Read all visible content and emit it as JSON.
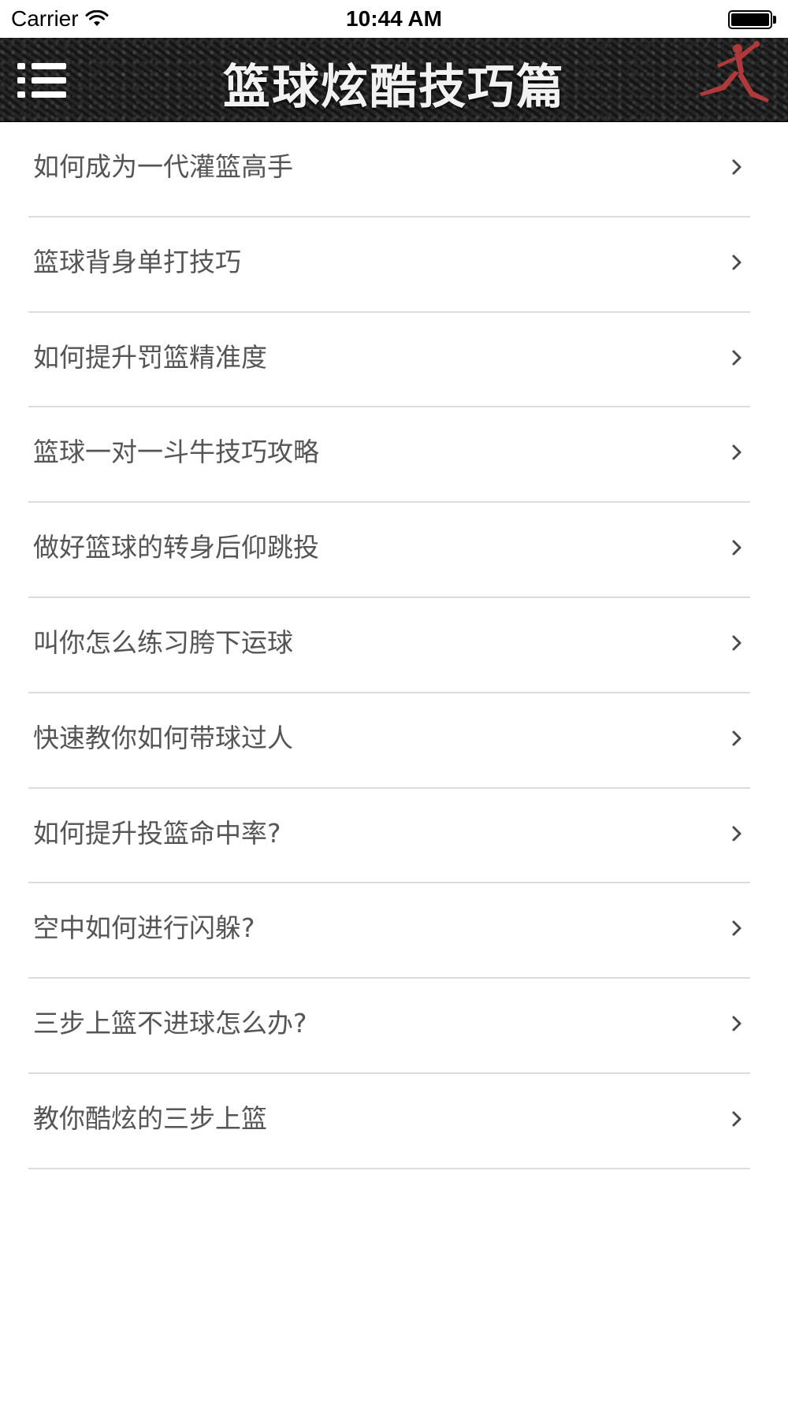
{
  "status_bar": {
    "carrier": "Carrier",
    "time": "10:44 AM",
    "icons": [
      "wifi-icon",
      "battery-icon"
    ]
  },
  "nav_bar": {
    "title": "篮球炫酷技巧篇",
    "left_icon": "menu-icon",
    "right_icon": "jumpman-logo"
  },
  "list": {
    "items": [
      {
        "label": "如何成为一代灌篮高手"
      },
      {
        "label": "篮球背身单打技巧"
      },
      {
        "label": "如何提升罚篮精准度"
      },
      {
        "label": "篮球一对一斗牛技巧攻略"
      },
      {
        "label": "做好篮球的转身后仰跳投"
      },
      {
        "label": "叫你怎么练习胯下运球"
      },
      {
        "label": "快速教你如何带球过人"
      },
      {
        "label": "如何提升投篮命中率?"
      },
      {
        "label": "空中如何进行闪躲?"
      },
      {
        "label": "三步上篮不进球怎么办?"
      },
      {
        "label": "教你酷炫的三步上篮"
      }
    ],
    "accessory_icon": "chevron-right-icon"
  },
  "colors": {
    "nav_background": "#1d1d1d",
    "nav_title": "#f2f2f2",
    "list_text": "#555555",
    "divider": "#dcdcdc",
    "chevron": "#4a4a4a",
    "logo_red": "#b0393b"
  }
}
